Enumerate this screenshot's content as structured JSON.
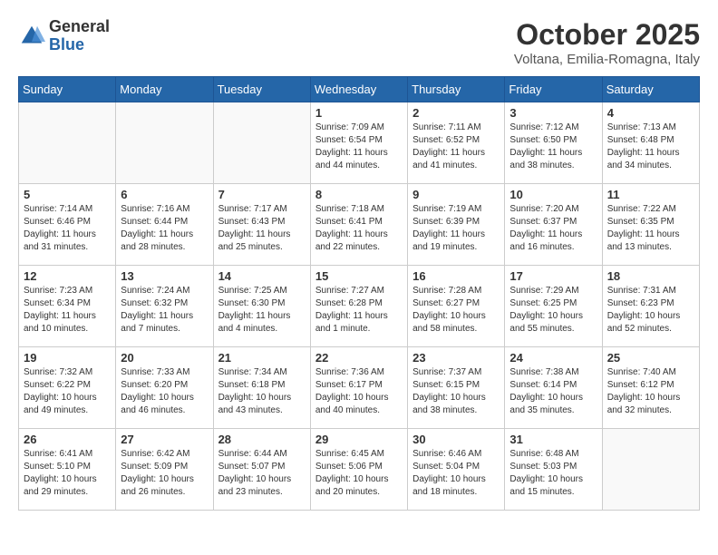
{
  "header": {
    "logo_general": "General",
    "logo_blue": "Blue",
    "month_title": "October 2025",
    "location": "Voltana, Emilia-Romagna, Italy"
  },
  "weekdays": [
    "Sunday",
    "Monday",
    "Tuesday",
    "Wednesday",
    "Thursday",
    "Friday",
    "Saturday"
  ],
  "weeks": [
    [
      {
        "day": "",
        "info": ""
      },
      {
        "day": "",
        "info": ""
      },
      {
        "day": "",
        "info": ""
      },
      {
        "day": "1",
        "info": "Sunrise: 7:09 AM\nSunset: 6:54 PM\nDaylight: 11 hours\nand 44 minutes."
      },
      {
        "day": "2",
        "info": "Sunrise: 7:11 AM\nSunset: 6:52 PM\nDaylight: 11 hours\nand 41 minutes."
      },
      {
        "day": "3",
        "info": "Sunrise: 7:12 AM\nSunset: 6:50 PM\nDaylight: 11 hours\nand 38 minutes."
      },
      {
        "day": "4",
        "info": "Sunrise: 7:13 AM\nSunset: 6:48 PM\nDaylight: 11 hours\nand 34 minutes."
      }
    ],
    [
      {
        "day": "5",
        "info": "Sunrise: 7:14 AM\nSunset: 6:46 PM\nDaylight: 11 hours\nand 31 minutes."
      },
      {
        "day": "6",
        "info": "Sunrise: 7:16 AM\nSunset: 6:44 PM\nDaylight: 11 hours\nand 28 minutes."
      },
      {
        "day": "7",
        "info": "Sunrise: 7:17 AM\nSunset: 6:43 PM\nDaylight: 11 hours\nand 25 minutes."
      },
      {
        "day": "8",
        "info": "Sunrise: 7:18 AM\nSunset: 6:41 PM\nDaylight: 11 hours\nand 22 minutes."
      },
      {
        "day": "9",
        "info": "Sunrise: 7:19 AM\nSunset: 6:39 PM\nDaylight: 11 hours\nand 19 minutes."
      },
      {
        "day": "10",
        "info": "Sunrise: 7:20 AM\nSunset: 6:37 PM\nDaylight: 11 hours\nand 16 minutes."
      },
      {
        "day": "11",
        "info": "Sunrise: 7:22 AM\nSunset: 6:35 PM\nDaylight: 11 hours\nand 13 minutes."
      }
    ],
    [
      {
        "day": "12",
        "info": "Sunrise: 7:23 AM\nSunset: 6:34 PM\nDaylight: 11 hours\nand 10 minutes."
      },
      {
        "day": "13",
        "info": "Sunrise: 7:24 AM\nSunset: 6:32 PM\nDaylight: 11 hours\nand 7 minutes."
      },
      {
        "day": "14",
        "info": "Sunrise: 7:25 AM\nSunset: 6:30 PM\nDaylight: 11 hours\nand 4 minutes."
      },
      {
        "day": "15",
        "info": "Sunrise: 7:27 AM\nSunset: 6:28 PM\nDaylight: 11 hours\nand 1 minute."
      },
      {
        "day": "16",
        "info": "Sunrise: 7:28 AM\nSunset: 6:27 PM\nDaylight: 10 hours\nand 58 minutes."
      },
      {
        "day": "17",
        "info": "Sunrise: 7:29 AM\nSunset: 6:25 PM\nDaylight: 10 hours\nand 55 minutes."
      },
      {
        "day": "18",
        "info": "Sunrise: 7:31 AM\nSunset: 6:23 PM\nDaylight: 10 hours\nand 52 minutes."
      }
    ],
    [
      {
        "day": "19",
        "info": "Sunrise: 7:32 AM\nSunset: 6:22 PM\nDaylight: 10 hours\nand 49 minutes."
      },
      {
        "day": "20",
        "info": "Sunrise: 7:33 AM\nSunset: 6:20 PM\nDaylight: 10 hours\nand 46 minutes."
      },
      {
        "day": "21",
        "info": "Sunrise: 7:34 AM\nSunset: 6:18 PM\nDaylight: 10 hours\nand 43 minutes."
      },
      {
        "day": "22",
        "info": "Sunrise: 7:36 AM\nSunset: 6:17 PM\nDaylight: 10 hours\nand 40 minutes."
      },
      {
        "day": "23",
        "info": "Sunrise: 7:37 AM\nSunset: 6:15 PM\nDaylight: 10 hours\nand 38 minutes."
      },
      {
        "day": "24",
        "info": "Sunrise: 7:38 AM\nSunset: 6:14 PM\nDaylight: 10 hours\nand 35 minutes."
      },
      {
        "day": "25",
        "info": "Sunrise: 7:40 AM\nSunset: 6:12 PM\nDaylight: 10 hours\nand 32 minutes."
      }
    ],
    [
      {
        "day": "26",
        "info": "Sunrise: 6:41 AM\nSunset: 5:10 PM\nDaylight: 10 hours\nand 29 minutes."
      },
      {
        "day": "27",
        "info": "Sunrise: 6:42 AM\nSunset: 5:09 PM\nDaylight: 10 hours\nand 26 minutes."
      },
      {
        "day": "28",
        "info": "Sunrise: 6:44 AM\nSunset: 5:07 PM\nDaylight: 10 hours\nand 23 minutes."
      },
      {
        "day": "29",
        "info": "Sunrise: 6:45 AM\nSunset: 5:06 PM\nDaylight: 10 hours\nand 20 minutes."
      },
      {
        "day": "30",
        "info": "Sunrise: 6:46 AM\nSunset: 5:04 PM\nDaylight: 10 hours\nand 18 minutes."
      },
      {
        "day": "31",
        "info": "Sunrise: 6:48 AM\nSunset: 5:03 PM\nDaylight: 10 hours\nand 15 minutes."
      },
      {
        "day": "",
        "info": ""
      }
    ]
  ]
}
